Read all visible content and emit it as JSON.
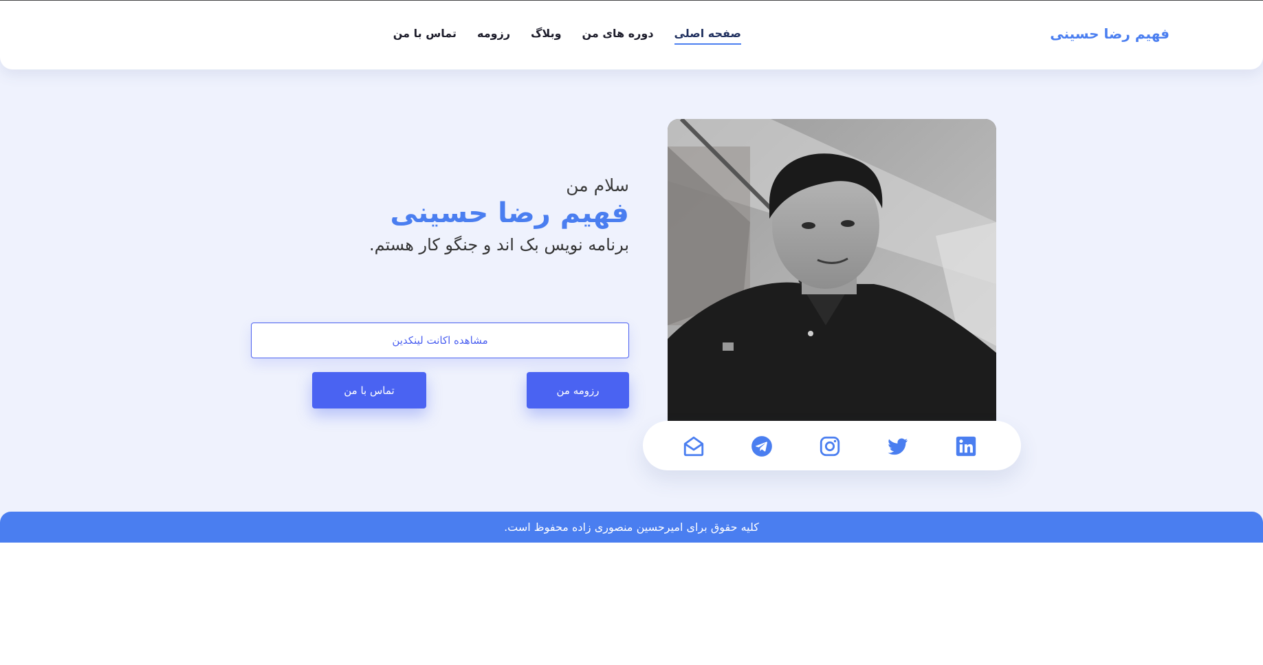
{
  "header": {
    "brand": "فهیم رضا حسینی",
    "nav": [
      {
        "label": "صفحه اصلی",
        "active": true
      },
      {
        "label": "دوره های من",
        "active": false
      },
      {
        "label": "وبلاگ",
        "active": false
      },
      {
        "label": "رزومه",
        "active": false
      },
      {
        "label": "تماس با من",
        "active": false
      }
    ]
  },
  "hero": {
    "greeting": "سلام من",
    "name": "فهیم رضا حسینی",
    "subtitle": "برنامه نویس بک اند و جنگو کار هستم.",
    "linkedin_button": "مشاهده اکانت لینکدین",
    "resume_button": "رزومه من",
    "contact_button": "تماس با من",
    "photo_icon": "profile-photo"
  },
  "social": [
    {
      "icon": "linkedin-icon"
    },
    {
      "icon": "twitter-icon"
    },
    {
      "icon": "instagram-icon"
    },
    {
      "icon": "telegram-icon"
    },
    {
      "icon": "mail-icon"
    }
  ],
  "footer": {
    "text": "کلیه حقوق برای امیرحسین منصوری زاده محفوظ است."
  },
  "colors": {
    "accent": "#4a7ef0",
    "button": "#4a63f2",
    "background": "#eff2fd"
  }
}
